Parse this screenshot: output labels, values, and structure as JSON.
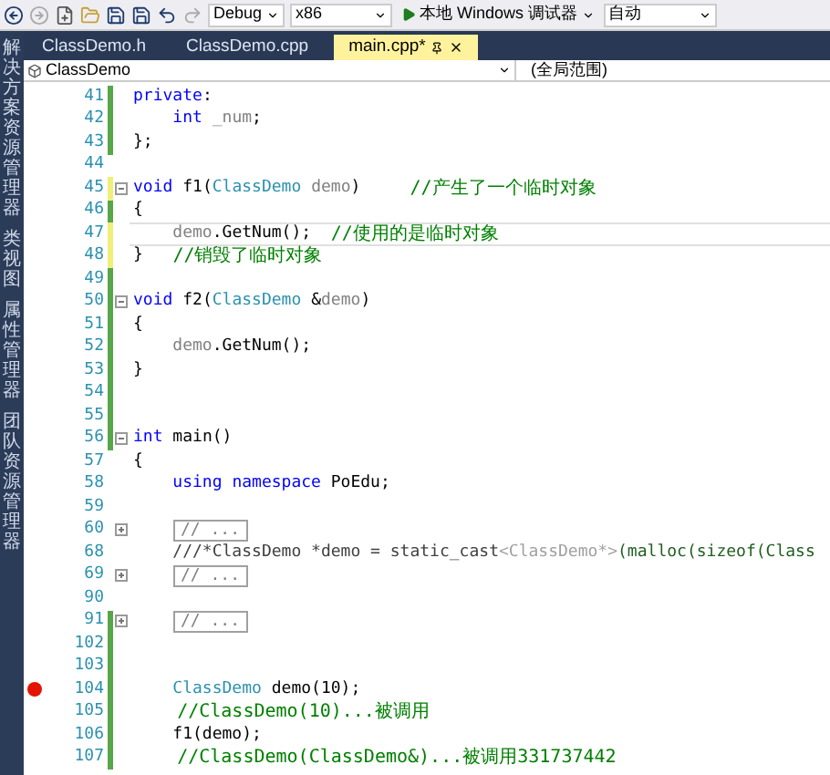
{
  "sidebar": {
    "panels": [
      {
        "label": "解决方案资源管理器"
      },
      {
        "label": "类视图"
      },
      {
        "label": "属性管理器"
      },
      {
        "label": "团队资源管理器"
      }
    ]
  },
  "toolbar": {
    "dropdowns": [
      {
        "kind": "config",
        "value": "Debug"
      },
      {
        "kind": "platform",
        "value": "x86"
      },
      {
        "kind": "run",
        "value": "本地 Windows 调试器"
      },
      {
        "kind": "plain",
        "value": "自动"
      }
    ]
  },
  "tabs": [
    {
      "label": "ClassDemo.h",
      "selected": false
    },
    {
      "label": "ClassDemo.cpp",
      "selected": false
    },
    {
      "label": "main.cpp*",
      "selected": true
    }
  ],
  "navbar": {
    "scope": "ClassDemo",
    "member": "(全局范围)"
  },
  "lines": [
    {
      "number": "41",
      "modified": true,
      "saved": true,
      "collapsible": false,
      "breakpoint": false,
      "current": false,
      "tokens": [
        {
          "kind": "kw",
          "text": "private"
        },
        {
          "kind": "plain",
          "text": ":"
        }
      ]
    },
    {
      "number": "42",
      "modified": true,
      "saved": true,
      "collapsible": false,
      "breakpoint": false,
      "current": false,
      "tokens": [
        {
          "kind": "kw",
          "text": "    int"
        },
        {
          "kind": "member",
          "text": " _num"
        },
        {
          "kind": "plain",
          "text": ";"
        }
      ]
    },
    {
      "number": "43",
      "modified": true,
      "saved": true,
      "collapsible": false,
      "breakpoint": false,
      "current": false,
      "tokens": [
        {
          "kind": "plain",
          "text": "};"
        }
      ]
    },
    {
      "number": "44",
      "modified": false,
      "collapsible": false,
      "breakpoint": false,
      "current": false
    },
    {
      "number": "45",
      "modified": true,
      "saved": false,
      "collapsible": true,
      "collapsed": false,
      "breakpoint": false,
      "current": false,
      "tokens": [
        {
          "kind": "kw",
          "text": "void"
        },
        {
          "kind": "plain",
          "text": " f1("
        },
        {
          "kind": "type",
          "text": "ClassDemo"
        },
        {
          "kind": "param",
          "text": " demo"
        },
        {
          "kind": "plain",
          "text": ")     "
        },
        {
          "kind": "comment",
          "text": "//产生了一个临时对象"
        }
      ]
    },
    {
      "number": "46",
      "modified": true,
      "saved": true,
      "collapsible": false,
      "breakpoint": false,
      "current": false,
      "tokens": [
        {
          "kind": "plain",
          "text": "{"
        }
      ]
    },
    {
      "number": "47",
      "modified": true,
      "saved": false,
      "collapsible": false,
      "breakpoint": false,
      "current": true,
      "tokens": [
        {
          "kind": "param",
          "text": "    demo"
        },
        {
          "kind": "plain",
          "text": ".GetNum();  "
        },
        {
          "kind": "comment",
          "text": "//使用的是临时对象"
        }
      ]
    },
    {
      "number": "48",
      "modified": true,
      "saved": false,
      "collapsible": false,
      "breakpoint": false,
      "current": false,
      "tokens": [
        {
          "kind": "plain",
          "text": "}   "
        },
        {
          "kind": "comment",
          "text": "//销毁了临时对象"
        }
      ]
    },
    {
      "number": "49",
      "modified": true,
      "saved": true,
      "collapsible": false,
      "breakpoint": false,
      "current": false
    },
    {
      "number": "50",
      "modified": true,
      "saved": true,
      "collapsible": true,
      "collapsed": false,
      "breakpoint": false,
      "current": false,
      "tokens": [
        {
          "kind": "kw",
          "text": "void"
        },
        {
          "kind": "plain",
          "text": " f2("
        },
        {
          "kind": "type",
          "text": "ClassDemo"
        },
        {
          "kind": "plain",
          "text": " &"
        },
        {
          "kind": "param",
          "text": "demo"
        },
        {
          "kind": "plain",
          "text": ")"
        }
      ]
    },
    {
      "number": "51",
      "modified": true,
      "saved": true,
      "collapsible": false,
      "breakpoint": false,
      "current": false,
      "tokens": [
        {
          "kind": "plain",
          "text": "{"
        }
      ]
    },
    {
      "number": "52",
      "modified": true,
      "saved": true,
      "collapsible": false,
      "breakpoint": false,
      "current": false,
      "tokens": [
        {
          "kind": "param",
          "text": "    demo"
        },
        {
          "kind": "plain",
          "text": ".GetNum();"
        }
      ]
    },
    {
      "number": "53",
      "modified": true,
      "saved": true,
      "collapsible": false,
      "breakpoint": false,
      "current": false,
      "tokens": [
        {
          "kind": "plain",
          "text": "}"
        }
      ]
    },
    {
      "number": "54",
      "modified": true,
      "saved": true,
      "collapsible": false,
      "breakpoint": false,
      "current": false
    },
    {
      "number": "55",
      "modified": true,
      "saved": true,
      "collapsible": false,
      "breakpoint": false,
      "current": false
    },
    {
      "number": "56",
      "modified": true,
      "saved": true,
      "collapsible": true,
      "collapsed": false,
      "breakpoint": false,
      "current": false,
      "tokens": [
        {
          "kind": "kw",
          "text": "int"
        },
        {
          "kind": "plain",
          "text": " main()"
        }
      ]
    },
    {
      "number": "57",
      "modified": false,
      "collapsible": false,
      "breakpoint": false,
      "current": false,
      "tokens": [
        {
          "kind": "plain",
          "text": "{"
        }
      ]
    },
    {
      "number": "58",
      "modified": false,
      "collapsible": false,
      "breakpoint": false,
      "current": false,
      "tokens": [
        {
          "kind": "kw",
          "text": "    using"
        },
        {
          "kind": "kw",
          "text": " namespace"
        },
        {
          "kind": "plain",
          "text": " PoEdu;"
        }
      ]
    },
    {
      "number": "59",
      "modified": false,
      "collapsible": false,
      "breakpoint": false,
      "current": false
    },
    {
      "number": "60",
      "modified": false,
      "collapsible": true,
      "collapsed": true,
      "breakpoint": false,
      "current": false,
      "tokens": [
        {
          "kind": "collapsed",
          "text": "// ..."
        }
      ]
    },
    {
      "number": "68",
      "modified": false,
      "collapsible": false,
      "breakpoint": false,
      "current": false,
      "tokens": [
        {
          "kind": "doc",
          "text": "    ///*ClassDemo *demo = static_cast"
        },
        {
          "kind": "docgray",
          "text": "<ClassDemo*>"
        },
        {
          "kind": "docgreen",
          "text": "(malloc(sizeof(Class"
        }
      ]
    },
    {
      "number": "69",
      "modified": false,
      "collapsible": true,
      "collapsed": true,
      "breakpoint": false,
      "current": false,
      "tokens": [
        {
          "kind": "collapsed",
          "text": "// ..."
        }
      ]
    },
    {
      "number": "90",
      "modified": false,
      "collapsible": false,
      "breakpoint": false,
      "current": false
    },
    {
      "number": "91",
      "modified": true,
      "saved": true,
      "collapsible": true,
      "collapsed": true,
      "breakpoint": false,
      "current": false,
      "tokens": [
        {
          "kind": "collapsed",
          "text": "// ..."
        }
      ]
    },
    {
      "number": "102",
      "modified": true,
      "saved": true,
      "collapsible": false,
      "breakpoint": false,
      "current": false
    },
    {
      "number": "103",
      "modified": true,
      "saved": true,
      "collapsible": false,
      "breakpoint": false,
      "current": false
    },
    {
      "number": "104",
      "modified": true,
      "saved": true,
      "collapsible": false,
      "breakpoint": true,
      "current": false,
      "tokens": [
        {
          "kind": "type",
          "text": "    ClassDemo"
        },
        {
          "kind": "plain",
          "text": " demo(10);"
        }
      ]
    },
    {
      "number": "105",
      "modified": true,
      "saved": true,
      "collapsible": false,
      "breakpoint": false,
      "current": false,
      "tokens": [
        {
          "kind": "comment",
          "text": "    //ClassDemo(10)...被调用"
        }
      ]
    },
    {
      "number": "106",
      "modified": true,
      "saved": true,
      "collapsible": false,
      "breakpoint": false,
      "current": false,
      "tokens": [
        {
          "kind": "plain",
          "text": "    f1(demo);"
        }
      ]
    },
    {
      "number": "107",
      "modified": true,
      "saved": true,
      "collapsible": false,
      "breakpoint": false,
      "current": false,
      "tokens": [
        {
          "kind": "comment",
          "text": "    //ClassDemo(ClassDemo&)...被调用331737442"
        }
      ]
    }
  ]
}
